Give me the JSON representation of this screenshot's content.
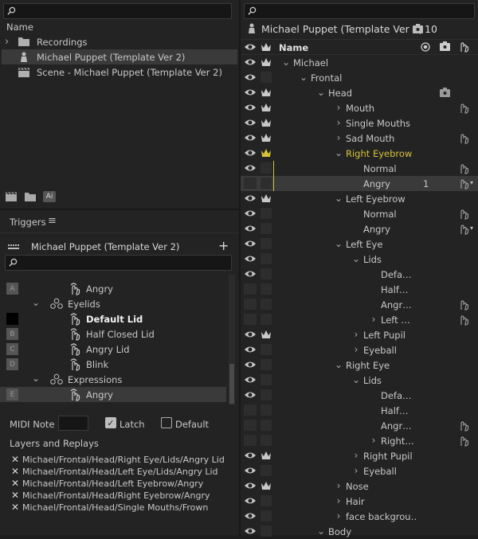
{
  "project": {
    "search_placeholder": "",
    "name_header": "Name",
    "items": [
      {
        "label": "Recordings",
        "icon": "folder-icon",
        "chev": "›"
      },
      {
        "label": "Michael Puppet (Template Ver 2)",
        "icon": "puppet-icon",
        "selected": true
      },
      {
        "label": "Scene - Michael Puppet (Template Ver 2)",
        "icon": "clapper-icon"
      }
    ],
    "bottom_icons": [
      "clapper-icon",
      "folder-icon",
      "ai-icon"
    ],
    "ai_label": "Ai"
  },
  "triggers": {
    "title": "Triggers",
    "menu_glyph": "≡",
    "puppet_name": "Michael Puppet (Template Ver 2)",
    "add_glyph": "+",
    "rows": [
      {
        "slot": "A",
        "label": "Angry",
        "indent": 2,
        "type": "trigger"
      },
      {
        "slot": "",
        "label": "Eyelids",
        "indent": 1,
        "type": "group",
        "chev": "⌄"
      },
      {
        "slot": "",
        "label": "Default Lid",
        "indent": 2,
        "type": "trigger",
        "bold": true,
        "slotblack": true
      },
      {
        "slot": "B",
        "label": "Half Closed Lid",
        "indent": 2,
        "type": "trigger"
      },
      {
        "slot": "C",
        "label": "Angry Lid",
        "indent": 2,
        "type": "trigger"
      },
      {
        "slot": "D",
        "label": "Blink",
        "indent": 2,
        "type": "trigger"
      },
      {
        "slot": "",
        "label": "Expressions",
        "indent": 1,
        "type": "group",
        "chev": "⌄"
      },
      {
        "slot": "E",
        "label": "Angry",
        "indent": 2,
        "type": "trigger",
        "selected": true
      }
    ],
    "midi_note_label": "MIDI Note",
    "midi_note_value": "",
    "latch_label": "Latch",
    "latch_checked": true,
    "default_label": "Default",
    "default_checked": false,
    "layers_title": "Layers and Replays",
    "layers": [
      "Michael/Frontal/Head/Right Eye/Lids/Angry Lid",
      "Michael/Frontal/Head/Left Eye/Lids/Angry Lid",
      "Michael/Frontal/Head/Left Eyebrow/Angry",
      "Michael/Frontal/Head/Right Eyebrow/Angry",
      "Michael/Frontal/Head/Single Mouths/Frown"
    ]
  },
  "puppet": {
    "title": "Michael Puppet (Template Ver 2)",
    "count": "10",
    "name_header": "Name",
    "rows": [
      {
        "label": "Michael",
        "indent": 0,
        "chev": "⌄",
        "eye": true,
        "crown": true
      },
      {
        "label": "Frontal",
        "indent": 1,
        "chev": "⌄",
        "eye": true,
        "crown": false
      },
      {
        "label": "Head",
        "indent": 2,
        "chev": "⌄",
        "eye": true,
        "crown": true,
        "tag": true
      },
      {
        "label": "Mouth",
        "indent": 3,
        "chev": "›",
        "eye": true,
        "crown": true,
        "hand": true
      },
      {
        "label": "Single Mouths",
        "indent": 3,
        "chev": "›",
        "eye": true,
        "crown": true
      },
      {
        "label": "Sad Mouth",
        "indent": 3,
        "chev": "›",
        "eye": true,
        "crown": true,
        "hand": true
      },
      {
        "label": "Right Eyebrow",
        "indent": 3,
        "chev": "⌄",
        "eye": true,
        "crown": true,
        "yellow": true
      },
      {
        "label": "Normal",
        "indent": 4,
        "chev": "",
        "eye": true,
        "crown": false,
        "hand": true,
        "yline": true
      },
      {
        "label": "Angry",
        "indent": 4,
        "chev": "",
        "eye": false,
        "crown": false,
        "hand": true,
        "dd": true,
        "selected": true,
        "num": "1",
        "yline": true
      },
      {
        "label": "Left Eyebrow",
        "indent": 3,
        "chev": "⌄",
        "eye": true,
        "crown": true
      },
      {
        "label": "Normal",
        "indent": 4,
        "chev": "",
        "eye": true,
        "crown": false,
        "hand": true
      },
      {
        "label": "Angry",
        "indent": 4,
        "chev": "",
        "eye": true,
        "crown": false,
        "hand": true,
        "dd": true
      },
      {
        "label": "Left Eye",
        "indent": 3,
        "chev": "⌄",
        "eye": true,
        "crown": false
      },
      {
        "label": "Lids",
        "indent": 4,
        "chev": "⌄",
        "eye": true,
        "crown": false
      },
      {
        "label": "Defa…",
        "indent": 5,
        "chev": "",
        "eye": true,
        "crown": false
      },
      {
        "label": "Half…",
        "indent": 5,
        "chev": "",
        "eye": false,
        "crown": false
      },
      {
        "label": "Angr…",
        "indent": 5,
        "chev": "",
        "eye": false,
        "crown": false,
        "hand": true
      },
      {
        "label": "Left …",
        "indent": 5,
        "chev": "›",
        "eye": false,
        "crown": false,
        "hand": true
      },
      {
        "label": "Left Pupil",
        "indent": 4,
        "chev": "›",
        "eye": true,
        "crown": true
      },
      {
        "label": "Eyeball",
        "indent": 4,
        "chev": "›",
        "eye": true,
        "crown": false
      },
      {
        "label": "Right Eye",
        "indent": 3,
        "chev": "⌄",
        "eye": true,
        "crown": false
      },
      {
        "label": "Lids",
        "indent": 4,
        "chev": "⌄",
        "eye": true,
        "crown": false
      },
      {
        "label": "Defa…",
        "indent": 5,
        "chev": "",
        "eye": true,
        "crown": false
      },
      {
        "label": "Half…",
        "indent": 5,
        "chev": "",
        "eye": false,
        "crown": false
      },
      {
        "label": "Angr…",
        "indent": 5,
        "chev": "",
        "eye": false,
        "crown": false,
        "hand": true
      },
      {
        "label": "Right…",
        "indent": 5,
        "chev": "›",
        "eye": false,
        "crown": false,
        "hand": true
      },
      {
        "label": "Right Pupil",
        "indent": 4,
        "chev": "›",
        "eye": true,
        "crown": true
      },
      {
        "label": "Eyeball",
        "indent": 4,
        "chev": "›",
        "eye": true,
        "crown": false
      },
      {
        "label": "Nose",
        "indent": 3,
        "chev": "›",
        "eye": true,
        "crown": true
      },
      {
        "label": "Hair",
        "indent": 3,
        "chev": "›",
        "eye": true,
        "crown": false
      },
      {
        "label": "face backgrou…",
        "indent": 3,
        "chev": "›",
        "eye": true,
        "crown": false
      },
      {
        "label": "Body",
        "indent": 2,
        "chev": "⌄",
        "eye": true,
        "crown": false
      }
    ]
  },
  "colors": {
    "accent_yellow": "#d6c13a",
    "bg": "#232323",
    "selected": "#3a3a3a"
  }
}
